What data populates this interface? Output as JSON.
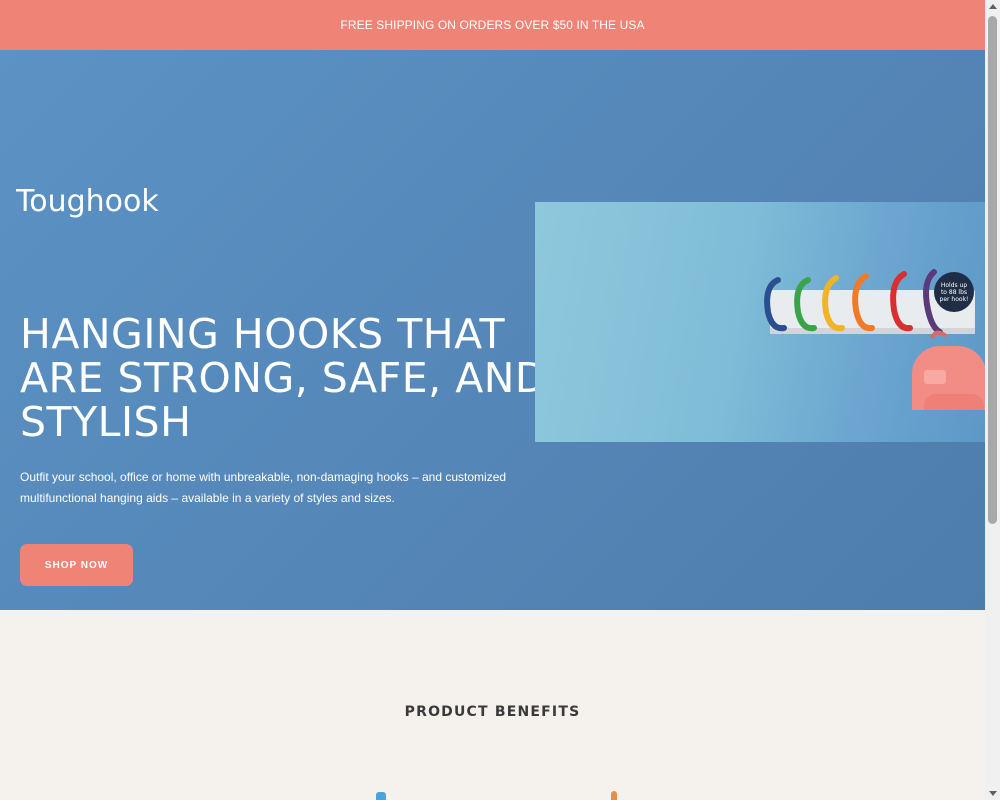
{
  "announcement": {
    "text": "FREE SHIPPING ON ORDERS OVER $50 IN THE USA"
  },
  "brand": {
    "logo_text": "Toughook"
  },
  "hero": {
    "headline": "HANGING HOOKS THAT ARE STRONG, SAFE, AND STYLISH",
    "subtext": "Outfit your school, office or home with unbreakable, non-damaging hooks – and customized multifunctional hanging aids – available in a variety of styles and sizes.",
    "cta_label": "SHOP NOW",
    "badge_text": "Holds up to 88 lbs per hook!"
  },
  "benefits": {
    "title": "PRODUCT BENEFITS"
  },
  "colors": {
    "accent": "#ef8376",
    "hero_bg": "#5586b8",
    "page_bg": "#f5f1ec",
    "hook_colors": [
      "#2a4f8f",
      "#3aa34a",
      "#f0b429",
      "#f07a2a",
      "#d8302f",
      "#5a3a7a"
    ]
  },
  "icons": [
    "toughook-logo",
    "hook-rack-image",
    "backpack-image",
    "capacity-badge"
  ]
}
